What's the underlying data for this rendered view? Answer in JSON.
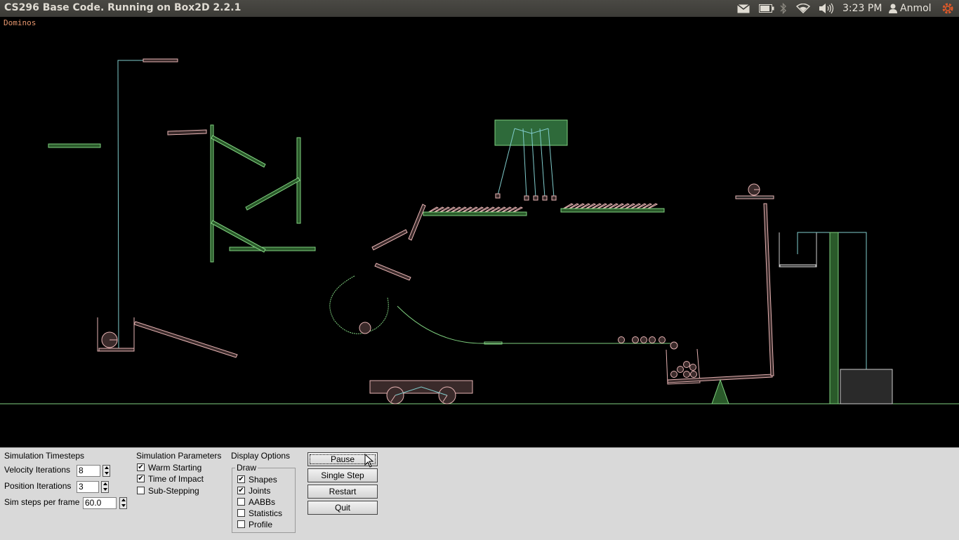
{
  "window": {
    "title": "CS296 Base Code. Running on Box2D 2.2.1"
  },
  "top_bar": {
    "time": "3:23 PM",
    "user": "Anmol",
    "icons": [
      "mail-icon",
      "battery-icon",
      "bluetooth-icon",
      "wifi-icon",
      "volume-icon",
      "user-icon",
      "power-gear-icon"
    ]
  },
  "canvas": {
    "scene_name": "Dominos"
  },
  "panel": {
    "timesteps": {
      "heading": "Simulation Timesteps",
      "velocity_label": "Velocity Iterations",
      "velocity_value": "8",
      "position_label": "Position Iterations",
      "position_value": "3",
      "steps_label": "Sim steps per frame",
      "steps_value": "60.0"
    },
    "parameters": {
      "heading": "Simulation Parameters",
      "warm_starting": "Warm Starting",
      "time_of_impact": "Time of Impact",
      "sub_stepping": "Sub-Stepping"
    },
    "display": {
      "heading": "Display Options",
      "draw_group": "Draw",
      "shapes": "Shapes",
      "joints": "Joints",
      "aabbs": "AABBs",
      "statistics": "Statistics",
      "profile": "Profile"
    },
    "buttons": {
      "pause": "Pause",
      "single_step": "Single Step",
      "restart": "Restart",
      "quit": "Quit"
    }
  },
  "colors": {
    "static_body": "#7fd07f",
    "dynamic_body": "#e6b3b3",
    "joint": "#80cccc",
    "panel_bg": "#d9d9d9"
  }
}
